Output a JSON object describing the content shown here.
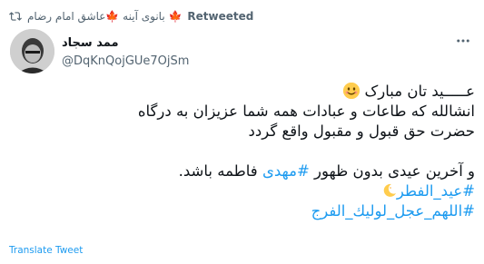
{
  "retweet": {
    "users": "بانوی آینه 🍁عاشق امام رضام 🍁",
    "label": "Retweeted"
  },
  "author": {
    "name": "ممد سجاد",
    "handle": "@DqKnQojGUe7OjSm"
  },
  "menu_icon": "more-horizontal-icon",
  "body": {
    "line1": "عـــــید تان مبارک",
    "line2": "انشالله که طاعات و عبادات همه شما عزیزان به درگاه",
    "line3": "حضرت حق قبول و مقبول واقع گردد",
    "line4_before": "و آخرین عیدی بدون ظهور ",
    "line4_tag": "#مهدی",
    "line4_after": " فاطمه باشد.",
    "hashtag1": "#عید_الفطر",
    "hashtag2": "#اللهم_عجل_لولیك_الفرج"
  },
  "translate_label": "Translate Tweet",
  "colors": {
    "link": "#1d9bf0",
    "muted": "#536471",
    "text": "#0f1419"
  }
}
